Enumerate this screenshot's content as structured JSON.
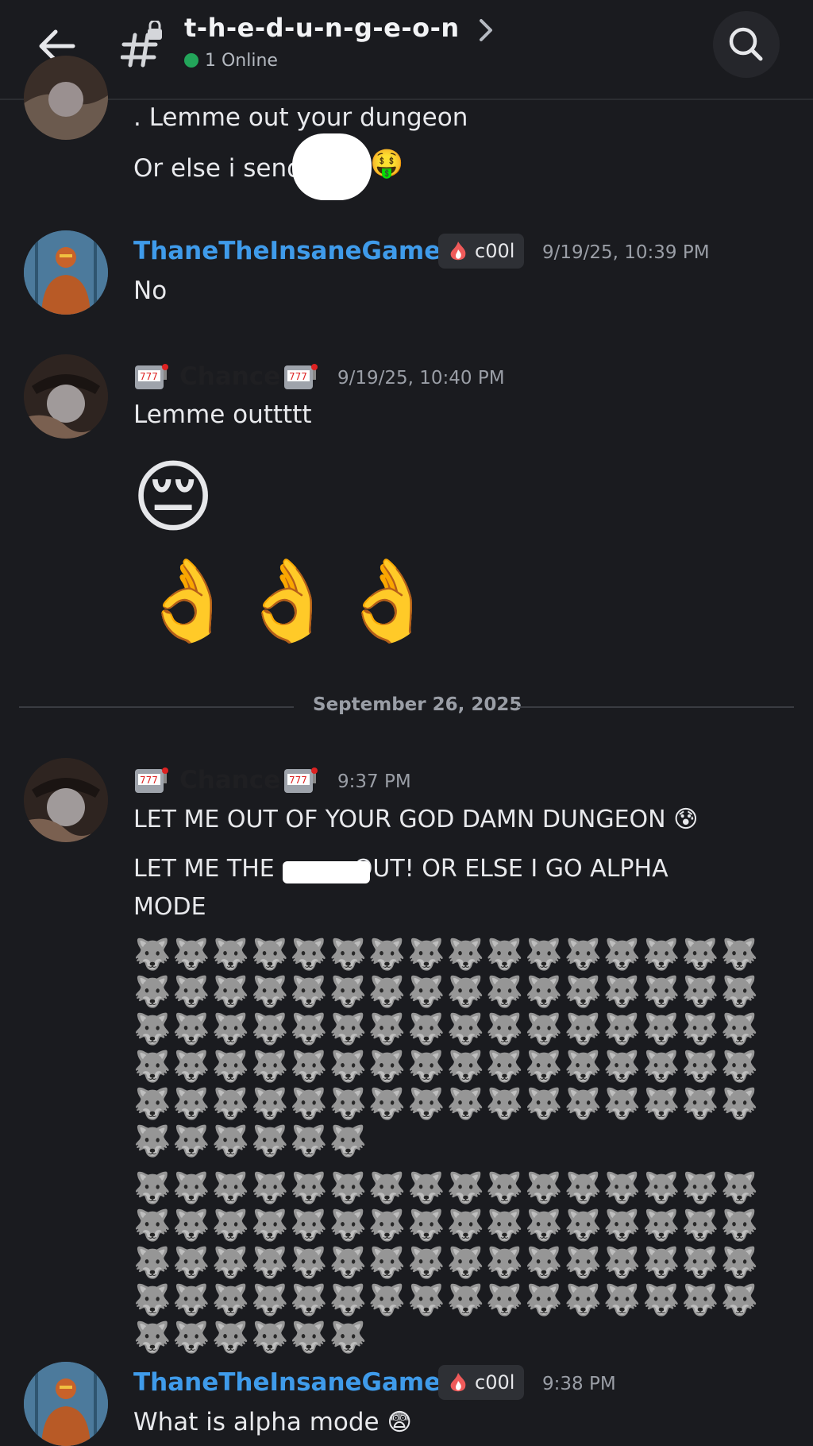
{
  "header": {
    "channel_name": "t-h-e-d-u-n-g-e-o-n",
    "online_status": "1 Online"
  },
  "messages": {
    "m0": {
      "line1": ". Lemme out your dungeon",
      "line2": "Or else i send",
      "emoji": "🤑"
    },
    "m1": {
      "username": "ThaneTheInsaneGamer",
      "tag": "c00l",
      "timestamp": "9/19/25, 10:39 PM",
      "text": "No"
    },
    "m2": {
      "username": "Chance",
      "timestamp": "9/19/25, 10:40 PM",
      "text": "Lemme outtttt",
      "emoji_big": "😔",
      "emoji_ok": "👌"
    },
    "date_divider": "September 26, 2025",
    "m3": {
      "username": "Chance",
      "timestamp": "9:37 PM",
      "line1": "LET ME OUT OF YOUR GOD DAMN DUNGEON",
      "line1_emoji": "😰",
      "line2a": "LET ME THE",
      "line2b": "OUT! OR ELSE I GO ALPHA",
      "line3": "MODE",
      "wolves_block1": "🐺🐺🐺🐺🐺🐺🐺🐺🐺🐺🐺🐺🐺🐺🐺🐺🐺🐺🐺🐺🐺🐺🐺🐺🐺🐺🐺🐺🐺🐺🐺🐺🐺🐺🐺🐺🐺🐺🐺🐺🐺🐺🐺🐺🐺🐺🐺🐺🐺🐺🐺🐺🐺🐺🐺🐺🐺🐺🐺🐺🐺🐺🐺🐺🐺🐺🐺🐺🐺🐺🐺🐺🐺🐺🐺🐺🐺🐺🐺🐺🐺🐺🐺🐺🐺🐺",
      "wolves_block2": "🐺🐺🐺🐺🐺🐺🐺🐺🐺🐺🐺🐺🐺🐺🐺🐺🐺🐺🐺🐺🐺🐺🐺🐺🐺🐺🐺🐺🐺🐺🐺🐺🐺🐺🐺🐺🐺🐺🐺🐺🐺🐺🐺🐺🐺🐺🐺🐺🐺🐺🐺🐺🐺🐺🐺🐺🐺🐺🐺🐺🐺🐺🐺🐺🐺🐺🐺🐺🐺🐺"
    },
    "m4": {
      "username": "ThaneTheInsaneGamer",
      "tag": "c00l",
      "timestamp": "9:38 PM",
      "text": "What is alpha mode",
      "emoji": "😨"
    }
  },
  "colors": {
    "background": "#1a1b1f",
    "thane_name": "#3f9bea",
    "online": "#23a55a"
  }
}
